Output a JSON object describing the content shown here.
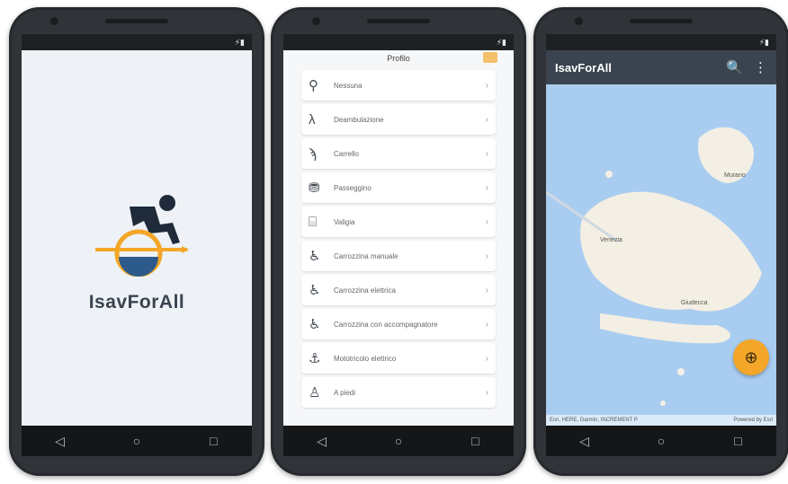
{
  "status_bar": {
    "icons": "⚡▮"
  },
  "nav": {
    "back": "◁",
    "home": "○",
    "recents": "□"
  },
  "splash": {
    "app_name": "IsavForAll"
  },
  "profile": {
    "title": "Profilo",
    "items": [
      {
        "icon": "walking-cane-icon",
        "label": "Nessuna"
      },
      {
        "icon": "elderly-icon",
        "label": "Deambulazione"
      },
      {
        "icon": "crutches-icon",
        "label": "Carrello"
      },
      {
        "icon": "stroller-icon",
        "label": "Passeggino"
      },
      {
        "icon": "luggage-icon",
        "label": "Valigia"
      },
      {
        "icon": "wheelchair-icon",
        "label": "Carrozzina manuale"
      },
      {
        "icon": "powered-wheelchair-icon",
        "label": "Carrozzina elettrica"
      },
      {
        "icon": "wheelchair-companion-icon",
        "label": "Carrozzina con accompagnatore"
      },
      {
        "icon": "mobility-scooter-icon",
        "label": "Mototricolo elettrico"
      },
      {
        "icon": "other-icon",
        "label": "A piedi"
      }
    ]
  },
  "map_screen": {
    "app_title": "IsavForAll",
    "map_labels": [
      "Venezia",
      "Murano",
      "Giudecca"
    ],
    "credit_left": "Esri, HERE, Garmin, INCREMENT P",
    "credit_right": "Powered by Esri"
  },
  "colors": {
    "accent": "#f3a627",
    "primary": "#3a4450",
    "water": "#a9cdf0",
    "land": "#f4efe4"
  }
}
